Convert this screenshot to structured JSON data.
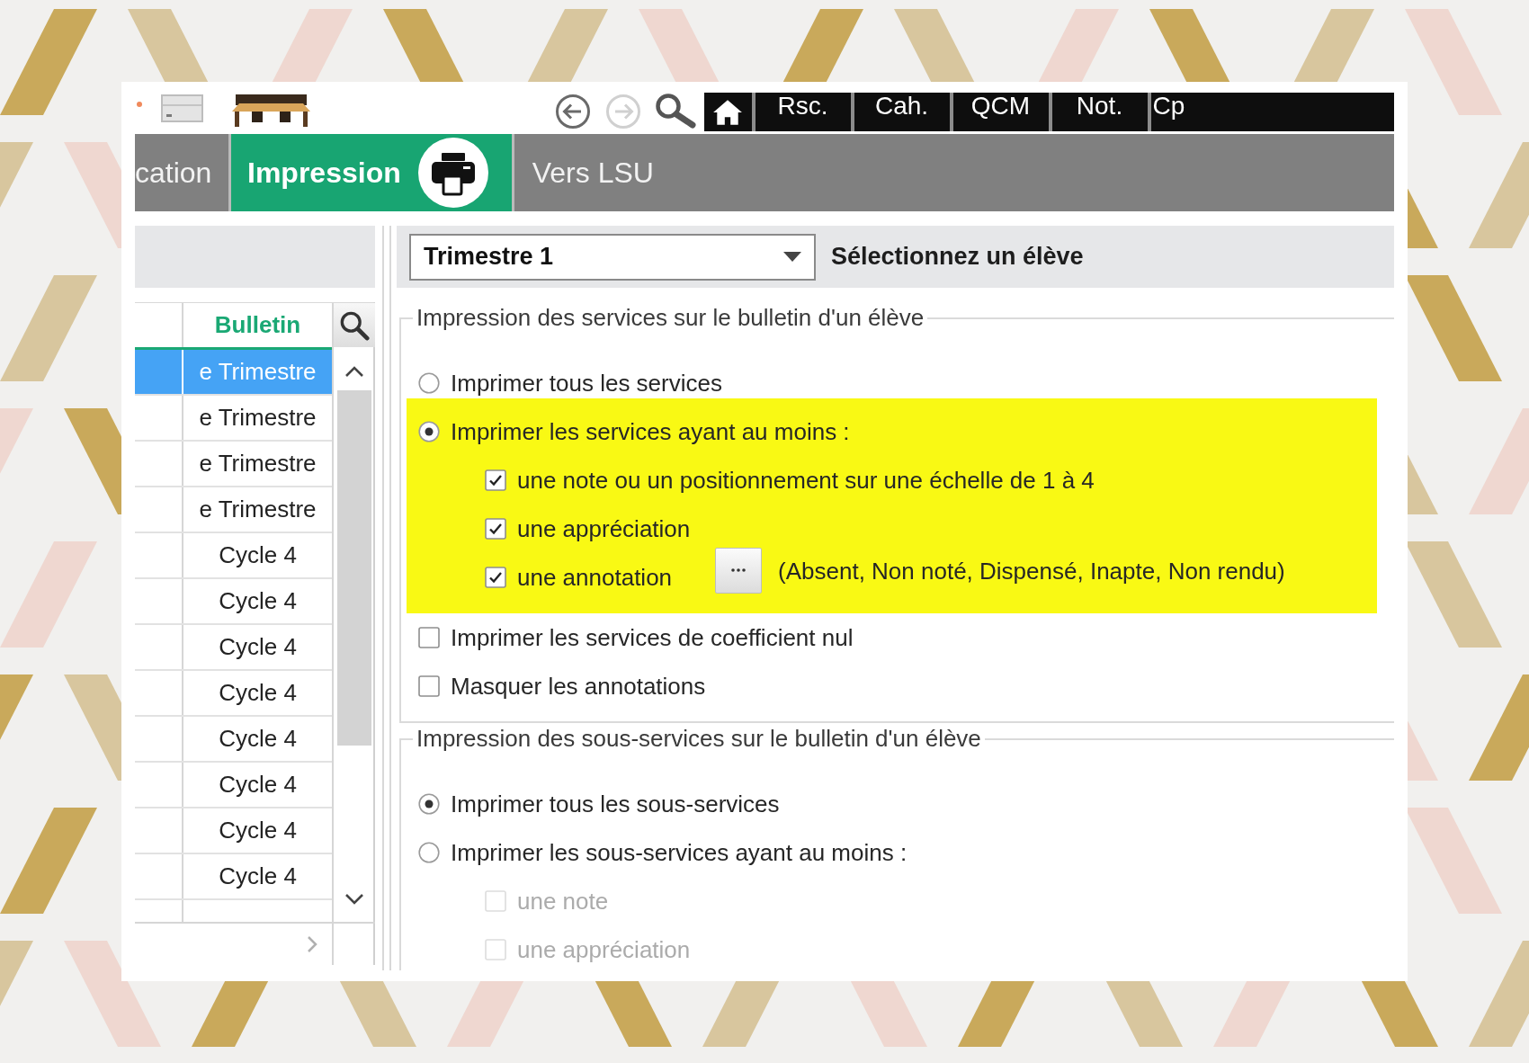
{
  "toolbar": {
    "navigation": [
      {
        "kind": "back",
        "disabled": false
      },
      {
        "kind": "forward",
        "disabled": true
      }
    ],
    "shortcuts": [
      "Rsc.",
      "Cah.",
      "QCM",
      "Not.",
      "Cp"
    ]
  },
  "tabs": [
    {
      "label": "cation",
      "selected": false
    },
    {
      "label": "Impression",
      "selected": true
    },
    {
      "label": "Vers LSU",
      "selected": false
    }
  ],
  "list_panel": {
    "columns": [
      "Bulletin"
    ],
    "rows": [
      {
        "value": "e Trimestre",
        "selected": true
      },
      {
        "value": "e Trimestre",
        "selected": false
      },
      {
        "value": "e Trimestre",
        "selected": false
      },
      {
        "value": "e Trimestre",
        "selected": false
      },
      {
        "value": "Cycle 4",
        "selected": false
      },
      {
        "value": "Cycle 4",
        "selected": false
      },
      {
        "value": "Cycle 4",
        "selected": false
      },
      {
        "value": "Cycle 4",
        "selected": false
      },
      {
        "value": "Cycle 4",
        "selected": false
      },
      {
        "value": "Cycle 4",
        "selected": false
      },
      {
        "value": "Cycle 4",
        "selected": false
      },
      {
        "value": "Cycle 4",
        "selected": false
      }
    ]
  },
  "period_dropdown": {
    "value": "Trimestre 1"
  },
  "student_prompt": "Sélectionnez un élève",
  "services_group": {
    "title": "Impression des services sur le bulletin d'un élève",
    "options": [
      {
        "kind": "radio",
        "label": "Imprimer tous les services",
        "selected": false,
        "disabled": false,
        "highlighted": false
      },
      {
        "kind": "radio",
        "label": "Imprimer les services ayant au moins :",
        "selected": true,
        "disabled": false,
        "highlighted": true,
        "children": [
          {
            "kind": "checkbox",
            "label": "une note ou un positionnement sur une échelle de 1 à 4",
            "checked": true,
            "disabled": false
          },
          {
            "kind": "checkbox",
            "label": "une appréciation",
            "checked": true,
            "disabled": false
          },
          {
            "kind": "checkbox",
            "label": "une annotation",
            "checked": true,
            "disabled": false,
            "detail_button": true,
            "note": "(Absent, Non noté, Dispensé, Inapte, Non rendu)"
          }
        ]
      },
      {
        "kind": "checkbox",
        "label": "Imprimer les services de coefficient nul",
        "checked": false,
        "disabled": false,
        "highlighted": false
      },
      {
        "kind": "checkbox",
        "label": "Masquer les annotations",
        "checked": false,
        "disabled": false,
        "highlighted": false
      }
    ]
  },
  "sub_services_group": {
    "title": "Impression des sous-services sur le bulletin d'un élève",
    "options": [
      {
        "kind": "radio",
        "label": "Imprimer tous les sous-services",
        "selected": true,
        "disabled": false,
        "highlighted": false
      },
      {
        "kind": "radio",
        "label": "Imprimer les sous-services ayant au moins :",
        "selected": false,
        "disabled": false,
        "highlighted": false,
        "children": [
          {
            "kind": "checkbox",
            "label": "une note",
            "checked": false,
            "disabled": true
          },
          {
            "kind": "checkbox",
            "label": "une appréciation",
            "checked": false,
            "disabled": true
          }
        ]
      }
    ]
  }
}
